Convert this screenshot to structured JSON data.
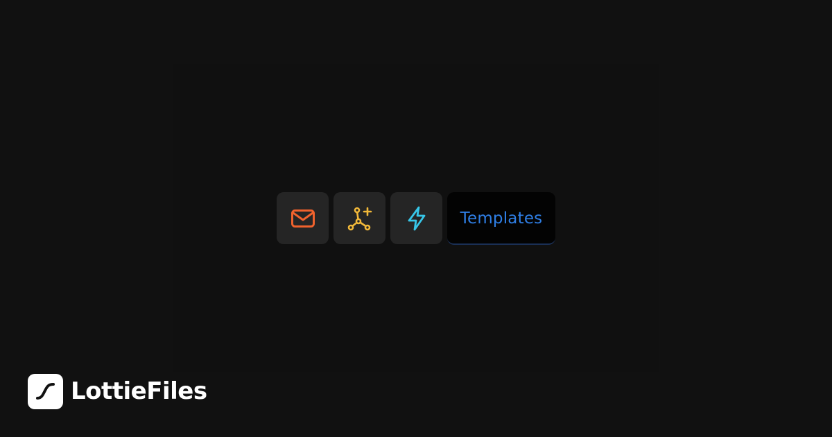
{
  "toolbar": {
    "buttons": [
      {
        "icon": "mail-icon",
        "color": "#f0622d"
      },
      {
        "icon": "network-add-icon",
        "color": "#f2b93a"
      },
      {
        "icon": "lightning-icon",
        "color": "#37c6e8"
      }
    ],
    "templates": {
      "label": "Templates",
      "color": "#2f7fe6"
    }
  },
  "brand": {
    "name": "LottieFiles",
    "logo_icon": "lottiefiles-logo-icon"
  }
}
